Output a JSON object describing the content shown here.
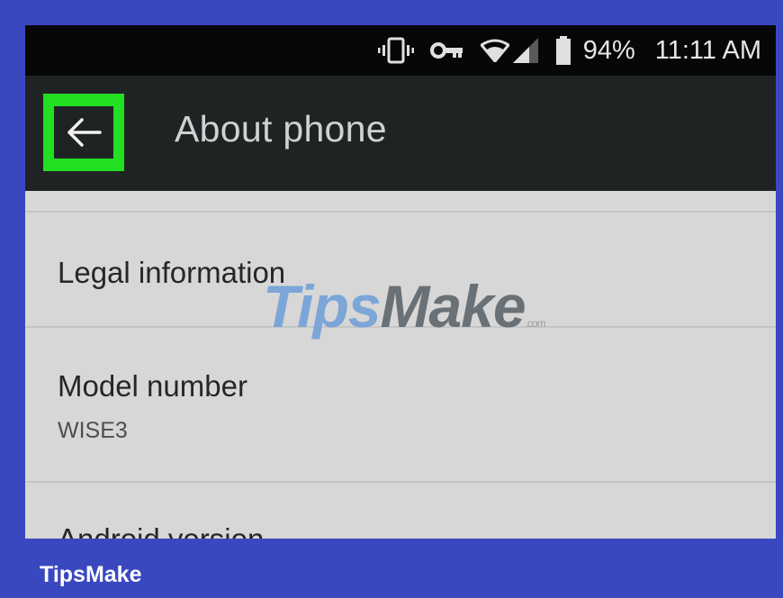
{
  "status_bar": {
    "icons": [
      "vibrate-icon",
      "vpn-key-icon",
      "wifi-icon",
      "signal-icon",
      "battery-icon"
    ],
    "battery": "94%",
    "time": "11:11 AM"
  },
  "app_bar": {
    "back_icon": "arrow-left-icon",
    "title": "About phone",
    "highlight_color": "#22df22"
  },
  "settings_items": [
    {
      "title": "Legal information",
      "subtitle": ""
    },
    {
      "title": "Model number",
      "subtitle": "WISE3"
    },
    {
      "title": "Android version",
      "subtitle": ""
    }
  ],
  "watermark": {
    "part1": "Tips",
    "part2": "Make",
    "suffix": ".com"
  },
  "brand_label": "TipsMake",
  "colors": {
    "frame": "#3a48c0",
    "app_bar": "#202324",
    "background": "#d7d7d7"
  }
}
